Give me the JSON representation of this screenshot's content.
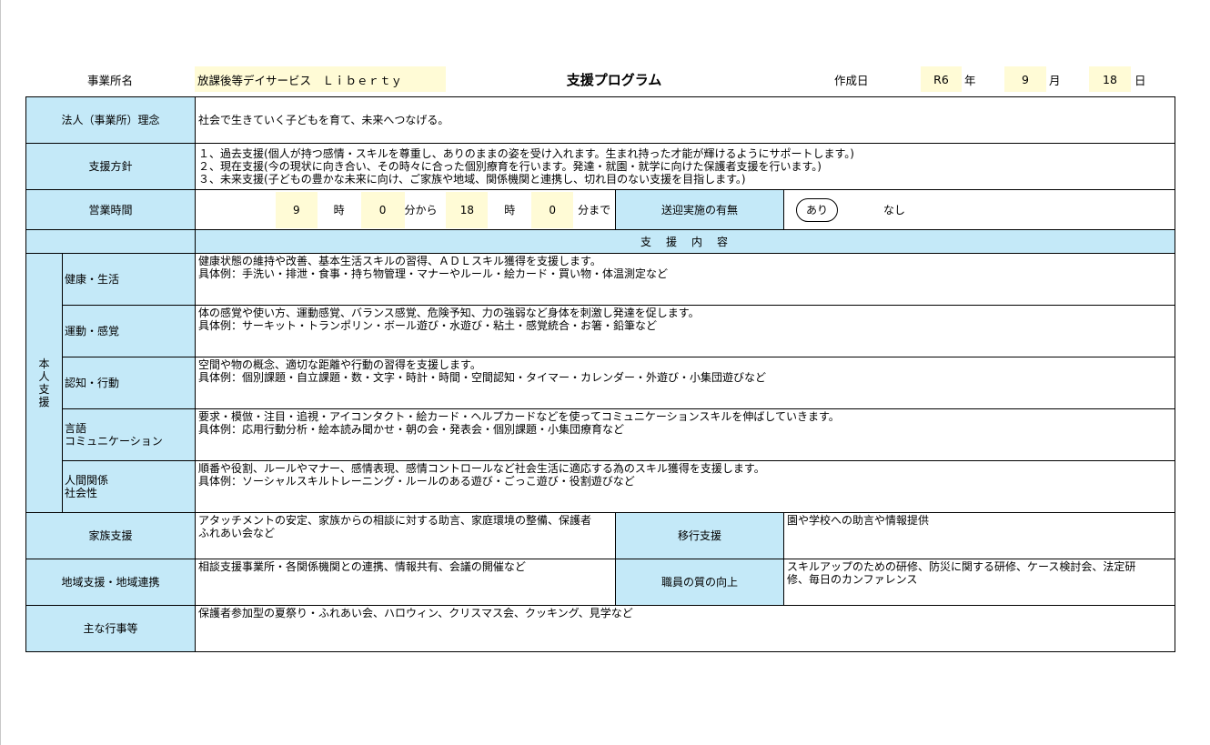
{
  "header": {
    "office_label": "事業所名",
    "office_name": "放課後等デイサービス　Ｌｉｂｅｒｔｙ",
    "title": "支援プログラム",
    "created_label": "作成日",
    "era": "R6",
    "year_unit": "年",
    "month": "9",
    "month_unit": "月",
    "day": "18",
    "day_unit": "日"
  },
  "philosophy": {
    "label": "法人（事業所）理念",
    "text": "社会で生きていく子どもを育て、未来へつなげる。"
  },
  "policy": {
    "label": "支援方針",
    "lines": [
      "１、過去支援(個人が持つ感情・スキルを尊重し、ありのままの姿を受け入れます。生まれ持った才能が輝けるようにサポートします。)",
      "２、現在支援(今の現状に向き合い、その時々に合った個別療育を行います。発達・就園・就学に向けた保護者支援を行います。)",
      "３、未来支援(子どもの豊かな未来に向け、ご家族や地域、関係機関と連携し、切れ目のない支援を目指します。)"
    ]
  },
  "hours": {
    "label": "営業時間",
    "start_hour": "9",
    "hour_unit": "時",
    "start_min": "0",
    "from_text": "分から",
    "end_hour": "18",
    "hour_unit2": "時",
    "end_min": "0",
    "until_text": "分まで"
  },
  "transport": {
    "label": "送迎実施の有無",
    "yes": "あり",
    "no": "なし"
  },
  "support_content_header": "支　援　内　容",
  "personal_support": {
    "label_chars": [
      "本",
      "人",
      "支",
      "援"
    ],
    "items": [
      {
        "label": "健康・生活",
        "line1": "健康状態の維持や改善、基本生活スキルの習得、ＡＤＬスキル獲得を支援します。",
        "line2": "具体例：手洗い・排泄・食事・持ち物管理・マナーやルール・絵カード・買い物・体温測定など"
      },
      {
        "label": "運動・感覚",
        "line1": "体の感覚や使い方、運動感覚、バランス感覚、危険予知、力の強弱など身体を刺激し発達を促します。",
        "line2": "具体例：サーキット・トランポリン・ボール遊び・水遊び・粘土・感覚統合・お箸・鉛筆など"
      },
      {
        "label": "認知・行動",
        "line1": "空間や物の概念、適切な距離や行動の習得を支援します。",
        "line2": "具体例：個別課題・自立課題・数・文字・時計・時間・空間認知・タイマー・カレンダー・外遊び・小集団遊びなど"
      },
      {
        "label1": "言語",
        "label2": "コミュニケーション",
        "line1": "要求・模倣・注目・追視・アイコンタクト・絵カード・ヘルプカードなどを使ってコミュニケーションスキルを伸ばしていきます。",
        "line2": "具体例：応用行動分析・絵本読み聞かせ・朝の会・発表会・個別課題・小集団療育など"
      },
      {
        "label1": "人間関係",
        "label2": "社会性",
        "line1": "順番や役割、ルールやマナー、感情表現、感情コントロールなど社会生活に適応する為のスキル獲得を支援します。",
        "line2": "具体例：ソーシャルスキルトレーニング・ルールのある遊び・ごっこ遊び・役割遊びなど"
      }
    ]
  },
  "family_support": {
    "label": "家族支援",
    "line1": "アタッチメントの安定、家族からの相談に対する助言、家庭環境の整備、保護者",
    "line2": "ふれあい会など"
  },
  "transition_support": {
    "label": "移行支援",
    "text": "園や学校への助言や情報提供"
  },
  "community_support": {
    "label": "地域支援・地域連携",
    "text": "相談支援事業所・各関係機関との連携、情報共有、会議の開催など"
  },
  "staff_quality": {
    "label": "職員の質の向上",
    "line1": "スキルアップのための研修、防災に関する研修、ケース検討会、法定研",
    "line2": "修、毎日のカンファレンス"
  },
  "events": {
    "label": "主な行事等",
    "text": "保護者参加型の夏祭り・ふれあい会、ハロウィン、クリスマス会、クッキング、見学など"
  }
}
